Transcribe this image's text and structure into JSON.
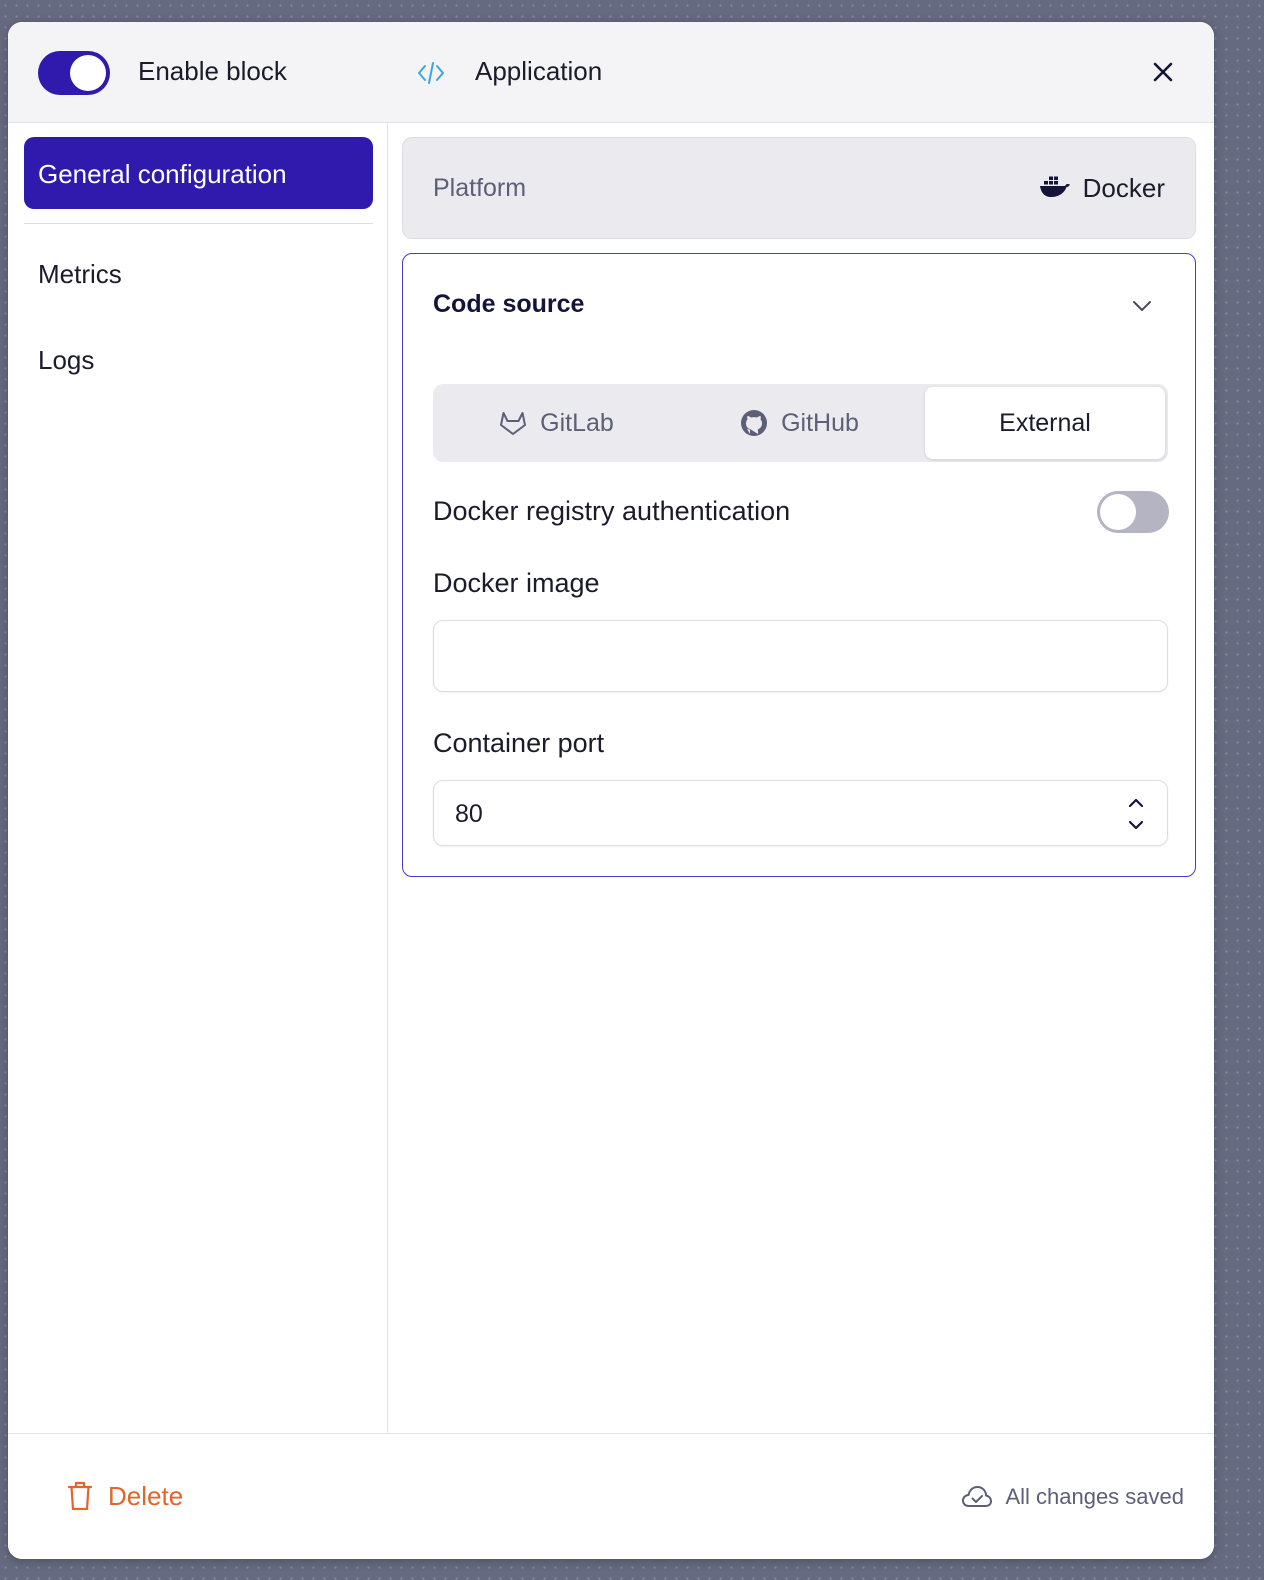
{
  "header": {
    "enable_toggle_on": true,
    "enable_label": "Enable block",
    "app_icon": "code-icon",
    "title": "Application",
    "close_icon": "close-icon"
  },
  "sidebar": {
    "items": [
      {
        "label": "General configuration",
        "active": true
      },
      {
        "label": "Metrics",
        "active": false
      },
      {
        "label": "Logs",
        "active": false
      }
    ]
  },
  "platform": {
    "label": "Platform",
    "icon": "docker-icon",
    "value": "Docker"
  },
  "code_source": {
    "title": "Code source",
    "tabs": [
      {
        "label": "GitLab",
        "icon": "gitlab-icon",
        "active": false
      },
      {
        "label": "GitHub",
        "icon": "github-icon",
        "active": false
      },
      {
        "label": "External",
        "icon": "",
        "active": true
      }
    ],
    "registry_auth_label": "Docker registry authentication",
    "registry_auth_enabled": false,
    "docker_image_label": "Docker image",
    "docker_image_value": "",
    "container_port_label": "Container port",
    "container_port_value": "80"
  },
  "footer": {
    "delete_label": "Delete",
    "save_status": "All changes saved"
  },
  "colors": {
    "accent": "#2f1aad",
    "danger": "#e0662c",
    "backdrop": "#666a80"
  }
}
